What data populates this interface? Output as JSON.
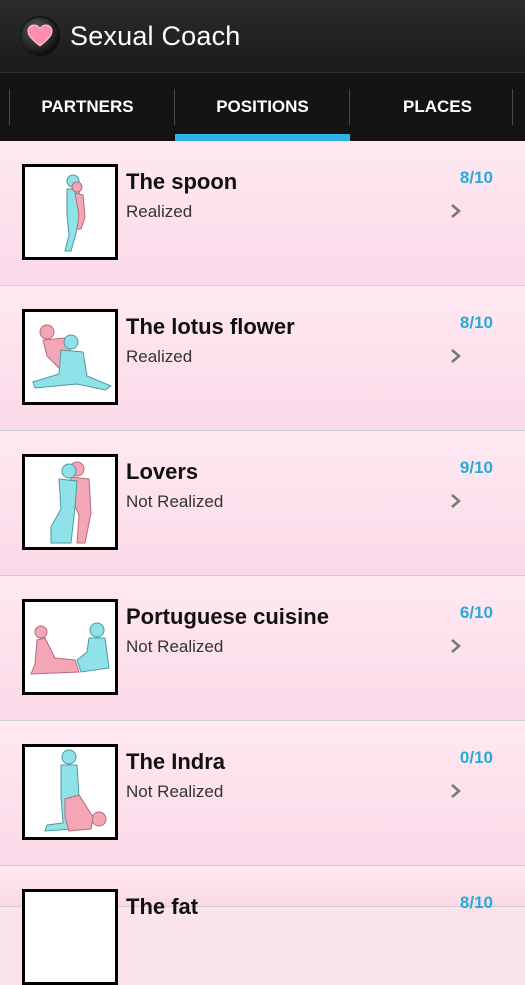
{
  "app": {
    "title": "Sexual Coach",
    "icon": "heart-icon"
  },
  "tabs": [
    {
      "label": "PARTNERS",
      "active": false
    },
    {
      "label": "POSITIONS",
      "active": true
    },
    {
      "label": "PLACES",
      "active": false
    }
  ],
  "items": [
    {
      "name": "The spoon",
      "status": "Realized",
      "score": "8/10"
    },
    {
      "name": "The lotus flower",
      "status": "Realized",
      "score": "8/10"
    },
    {
      "name": "Lovers",
      "status": "Not Realized",
      "score": "9/10"
    },
    {
      "name": "Portuguese cuisine",
      "status": "Not Realized",
      "score": "6/10"
    },
    {
      "name": "The Indra",
      "status": "Not Realized",
      "score": "0/10"
    },
    {
      "name": "The fat",
      "status": "",
      "score": "8/10"
    }
  ],
  "colors": {
    "accent": "#29b6e6",
    "row_bg": "#fbe3ee",
    "figure_blue": "#8fe3e8",
    "figure_pink": "#f2a6b6"
  }
}
